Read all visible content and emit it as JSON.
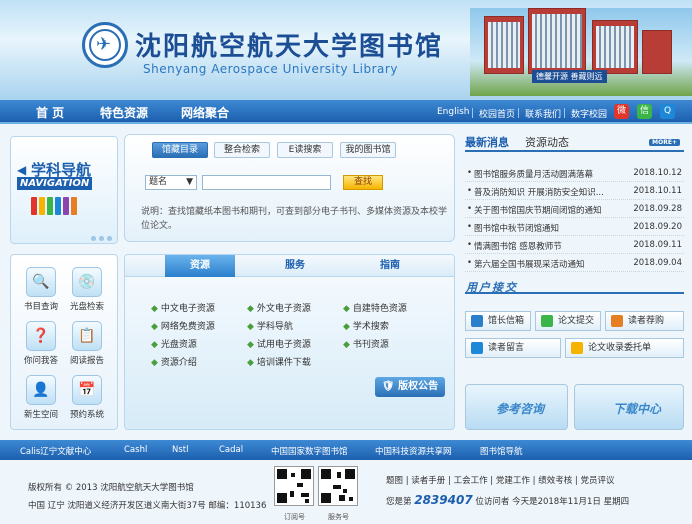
{
  "header": {
    "title_cn": "沈阳航空航天大学图书馆",
    "title_en": "Shenyang Aerospace University Library",
    "sign_text": "德馨开源 善藏则远"
  },
  "nav": {
    "main": [
      "首 页",
      "特色资源",
      "网络聚合"
    ],
    "utils": [
      "English",
      "校园首页",
      "联系我们",
      "数字校园"
    ]
  },
  "subject_nav": {
    "title": "学科导航",
    "subtitle": "NAVIGATION"
  },
  "search": {
    "tabs": [
      "馆藏目录",
      "整合检索",
      "E读搜索",
      "我的图书馆"
    ],
    "select_value": "题名",
    "button": "查找",
    "note": "说明：查找馆藏纸本图书和期刊，可查到部分电子书刊、多媒体资源及本校学位论文。"
  },
  "news": {
    "tabs": [
      "最新消息",
      "资源动态"
    ],
    "more": "MORE+",
    "items": [
      {
        "title": "图书馆服务质量月活动圆满落幕",
        "date": "2018.10.12"
      },
      {
        "title": "普及消防知识 开展消防安全知识...",
        "date": "2018.10.11"
      },
      {
        "title": "关于图书馆国庆节期间闭馆的通知",
        "date": "2018.09.28"
      },
      {
        "title": "图书馆中秋节闭馆通知",
        "date": "2018.09.20"
      },
      {
        "title": "情满图书馆 感恩教师节",
        "date": "2018.09.11"
      },
      {
        "title": "第六届全国书展现采活动通知",
        "date": "2018.09.04"
      }
    ]
  },
  "quick_links": [
    "书目查询",
    "光盘检索",
    "你问我答",
    "阅读报告",
    "新生空间",
    "预约系统"
  ],
  "resources": {
    "tabs": [
      "资源",
      "服务",
      "指南"
    ],
    "items": [
      "中文电子资源",
      "外文电子资源",
      "自建特色资源",
      "网络免费资源",
      "学科导航",
      "学术搜索",
      "光盘资源",
      "试用电子资源",
      "书刊资源",
      "资源介绍",
      "培训课件下载"
    ],
    "copyright": "版权公告"
  },
  "services": {
    "title": "用户接交",
    "items": [
      "馆长信箱",
      "论文提交",
      "读者荐购",
      "读者留言",
      "论文收录委托单"
    ],
    "big_buttons": [
      "参考咨询",
      "下载中心"
    ]
  },
  "links": [
    "Calis辽宁文献中心",
    "Cashl",
    "Nstl",
    "Cadal",
    "中国国家数字图书馆",
    "中国科技资源共享网",
    "图书馆导航"
  ],
  "footer": {
    "copyright": "版权所有 © 2013 沈阳航空航天大学图书馆",
    "address": "中国 辽宁 沈阳道义经济开发区道义南大街37号 邮编：110136",
    "qr_labels": [
      "订阅号",
      "服务号"
    ],
    "bottom_links": [
      "题图",
      "读者手册",
      "工会工作",
      "党建工作",
      "绩效考核",
      "党员评议"
    ],
    "visitor_prefix": "您是第",
    "visitor_count": "2839407",
    "visitor_suffix": "位访问者 今天是2018年11月1日 星期四"
  }
}
